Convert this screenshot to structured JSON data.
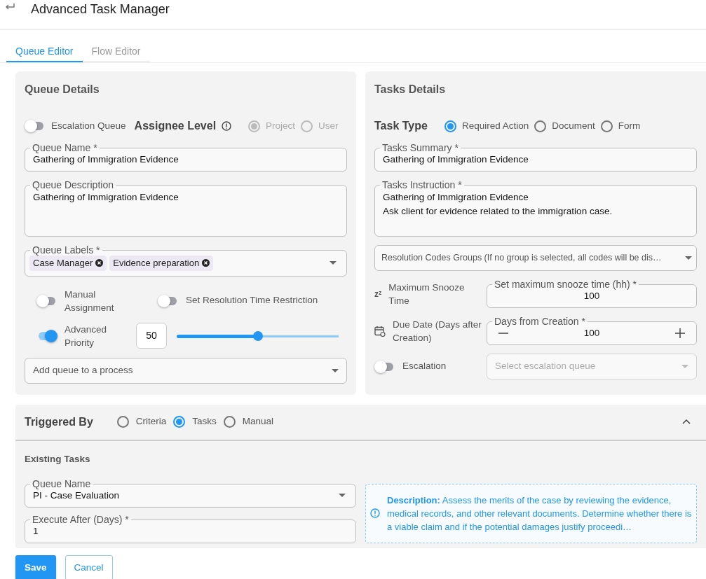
{
  "header": {
    "title": "Advanced Task Manager"
  },
  "tabs": [
    {
      "label": "Queue Editor",
      "selected": true
    },
    {
      "label": "Flow Editor",
      "selected": false
    }
  ],
  "queue_details": {
    "title": "Queue Details",
    "escalation_queue": {
      "label": "Escalation Queue",
      "on": false
    },
    "assignee_level": {
      "label": "Assignee Level",
      "options": [
        {
          "label": "Project",
          "selected": true,
          "disabled": true
        },
        {
          "label": "User",
          "selected": false,
          "disabled": true
        }
      ]
    },
    "queue_name": {
      "label": "Queue Name *",
      "value": "Gathering of Immigration Evidence"
    },
    "queue_description": {
      "label": "Queue Description",
      "value": "Gathering of Immigration Evidence"
    },
    "queue_labels": {
      "label": "Queue Labels *",
      "chips": [
        "Case Manager",
        "Evidence preparation"
      ]
    },
    "manual_assignment": {
      "label": "Manual Assignment",
      "on": false
    },
    "resolution_time_restriction": {
      "label": "Set Resolution Time Restriction",
      "on": false
    },
    "advanced_priority": {
      "label": "Advanced Priority",
      "on": true,
      "value": "50",
      "level": 0.5
    },
    "process": {
      "placeholder": "Add queue to a process"
    }
  },
  "tasks_details": {
    "title": "Tasks Details",
    "task_type": {
      "label": "Task Type",
      "options": [
        {
          "label": "Required Action",
          "selected": true
        },
        {
          "label": "Document",
          "selected": false
        },
        {
          "label": "Form",
          "selected": false
        }
      ]
    },
    "summary": {
      "label": "Tasks Summary *",
      "value": "Gathering of Immigration Evidence"
    },
    "instruction": {
      "label": "Tasks Instruction *",
      "lines": [
        "Gathering of Immigration Evidence",
        "Ask client for evidence related to the immigration case."
      ]
    },
    "resolution_codes": {
      "placeholder": "Resolution Codes Groups (If no group is selected, all codes will be dis…"
    },
    "snooze": {
      "icon": "zᶻ",
      "label": "Maximum Snooze Time",
      "field_label": "Set maximum snooze time (hh) *",
      "value": "100"
    },
    "due_date": {
      "label": "Due Date (Days after Creation)",
      "field_label": "Days from Creation *",
      "value": "100"
    },
    "escalation": {
      "label": "Escalation",
      "on": false,
      "placeholder": "Select escalation queue",
      "disabled": true
    }
  },
  "triggered_by": {
    "label": "Triggered By",
    "expanded": true,
    "options": [
      {
        "label": "Criteria",
        "selected": false
      },
      {
        "label": "Tasks",
        "selected": true
      },
      {
        "label": "Manual",
        "selected": false
      }
    ],
    "existing_tasks": {
      "title": "Existing Tasks",
      "queue_name": {
        "label": "Queue Name",
        "value": "PI - Case Evaluation"
      },
      "execute_after": {
        "label": "Execute After (Days) *",
        "value": "1"
      },
      "description": "**Description:** Assess the merits of the case by reviewing the evidence, medical records, and other relevant documents. Determine whether there is a viable claim and if the potential damages justify proceedi…"
    }
  },
  "buttons": [
    {
      "label": "Save",
      "kind": "primary"
    },
    {
      "label": "Cancel",
      "kind": "outline"
    }
  ]
}
